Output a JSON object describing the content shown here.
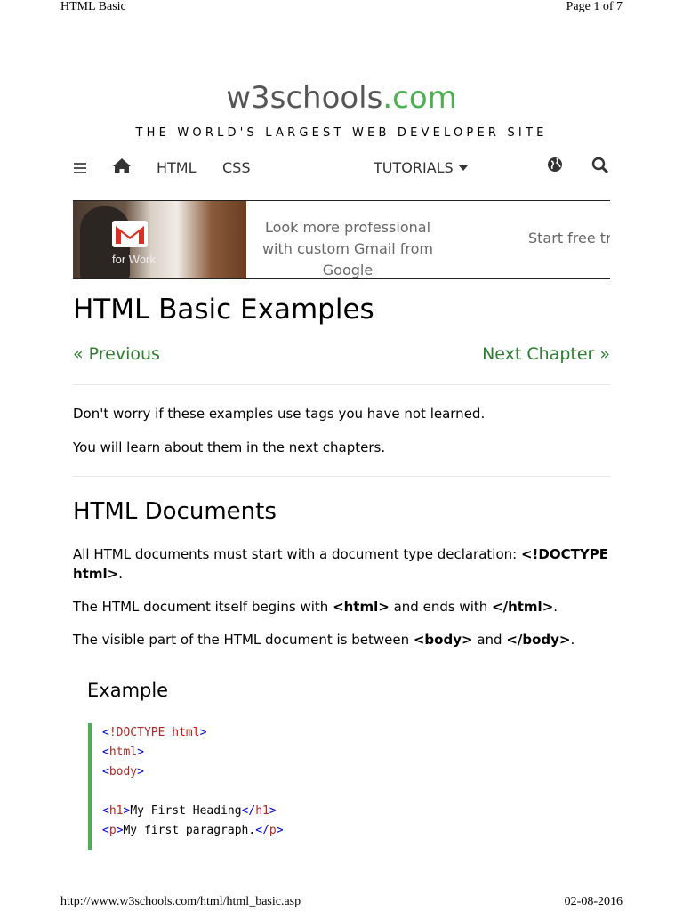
{
  "print_header": {
    "title": "HTML Basic",
    "page": "Page 1 of 7"
  },
  "print_footer": {
    "url": "http://www.w3schools.com/html/html_basic.asp",
    "date": "02-08-2016"
  },
  "logo": {
    "name": "w3schools",
    "tld": ".com"
  },
  "tagline": "THE WORLD'S LARGEST WEB DEVELOPER SITE",
  "nav": {
    "html": "HTML",
    "css": "CSS",
    "tutorials": "TUTORIALS",
    "icons": [
      "menu-icon",
      "home-icon",
      "caret-down-icon",
      "globe-icon",
      "search-icon"
    ]
  },
  "ad": {
    "image_caption": "for Work",
    "text": "Look more professional with custom Gmail from Google",
    "cta": "Start free tr"
  },
  "title": "HTML Basic Examples",
  "pager": {
    "prev": "« Previous",
    "next": "Next Chapter »"
  },
  "intro": [
    "Don't worry if these examples use tags you have not learned.",
    "You will learn about them in the next chapters."
  ],
  "section": {
    "title": "HTML Documents",
    "p1_before": "All HTML documents must start with a document type declaration: ",
    "p1_bold": "<!DOCTYPE html>",
    "p1_after": ".",
    "p2_before": "The HTML document itself begins with ",
    "p2_bold1": "<html>",
    "p2_mid": " and ends with ",
    "p2_bold2": "</html>",
    "p2_after": ".",
    "p3_before": "The visible part of the HTML document is between ",
    "p3_bold1": "<body>",
    "p3_mid": " and ",
    "p3_bold2": "</body>",
    "p3_after": "."
  },
  "example": {
    "title": "Example",
    "code": {
      "l1_open": "<",
      "l1_doctype": "!DOCTYPE",
      "l1_attr": " html",
      "l1_close": ">",
      "l2_open": "<",
      "l2_name": "html",
      "l2_close": ">",
      "l3_open": "<",
      "l3_name": "body",
      "l3_close": ">",
      "l4_open": "<",
      "l4_name": "h1",
      "l4_close": ">",
      "l4_text": "My First Heading",
      "l4_end_open": "</",
      "l4_end_name": "h1",
      "l4_end_close": ">",
      "l5_open": "<",
      "l5_name": "p",
      "l5_close": ">",
      "l5_text": "My first paragraph.",
      "l5_end_open": "</",
      "l5_end_name": "p",
      "l5_end_close": ">"
    }
  },
  "colors": {
    "brand_green": "#4CAF50",
    "link_green": "#2E7D32",
    "logo_gray": "#555555"
  }
}
